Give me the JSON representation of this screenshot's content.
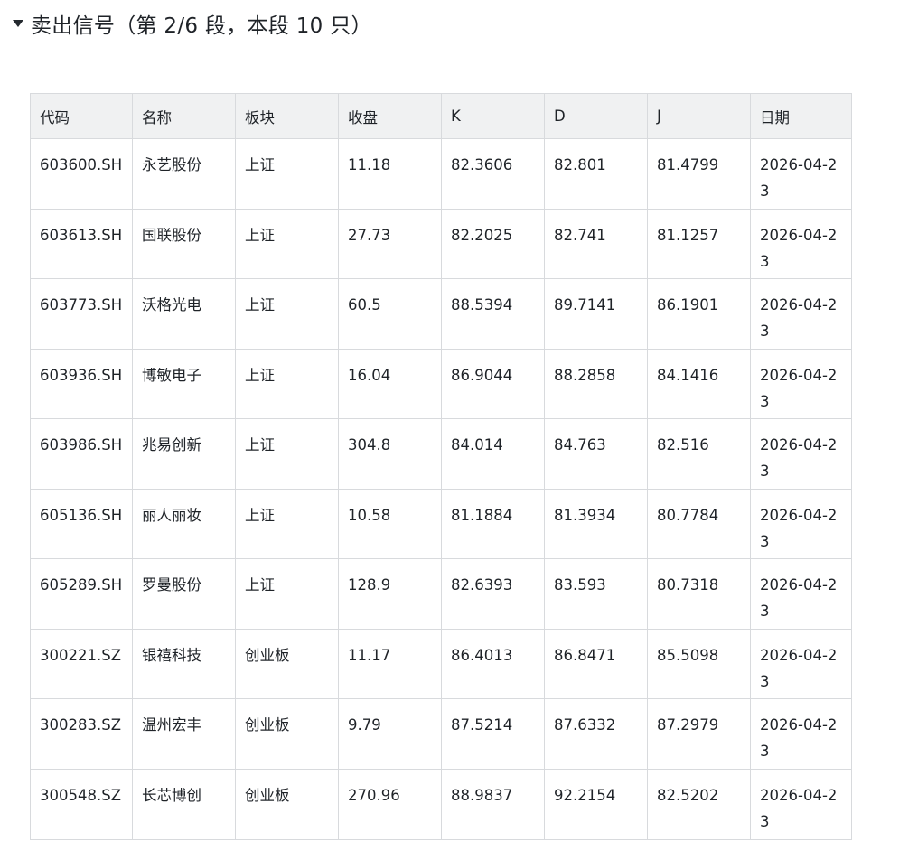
{
  "section": {
    "title": "卖出信号（第 2/6 段，本段 10 只）",
    "toggle_icon": "triangle-down-icon"
  },
  "table": {
    "headers": [
      "代码",
      "名称",
      "板块",
      "收盘",
      "K",
      "D",
      "J",
      "日期"
    ],
    "rows": [
      [
        "603600.SH",
        "永艺股份",
        "上证",
        "11.18",
        "82.3606",
        "82.801",
        "81.4799",
        "2026-04-23"
      ],
      [
        "603613.SH",
        "国联股份",
        "上证",
        "27.73",
        "82.2025",
        "82.741",
        "81.1257",
        "2026-04-23"
      ],
      [
        "603773.SH",
        "沃格光电",
        "上证",
        "60.5",
        "88.5394",
        "89.7141",
        "86.1901",
        "2026-04-23"
      ],
      [
        "603936.SH",
        "博敏电子",
        "上证",
        "16.04",
        "86.9044",
        "88.2858",
        "84.1416",
        "2026-04-23"
      ],
      [
        "603986.SH",
        "兆易创新",
        "上证",
        "304.8",
        "84.014",
        "84.763",
        "82.516",
        "2026-04-23"
      ],
      [
        "605136.SH",
        "丽人丽妆",
        "上证",
        "10.58",
        "81.1884",
        "81.3934",
        "80.7784",
        "2026-04-23"
      ],
      [
        "605289.SH",
        "罗曼股份",
        "上证",
        "128.9",
        "82.6393",
        "83.593",
        "80.7318",
        "2026-04-23"
      ],
      [
        "300221.SZ",
        "银禧科技",
        "创业板",
        "11.17",
        "86.4013",
        "86.8471",
        "85.5098",
        "2026-04-23"
      ],
      [
        "300283.SZ",
        "温州宏丰",
        "创业板",
        "9.79",
        "87.5214",
        "87.6332",
        "87.2979",
        "2026-04-23"
      ],
      [
        "300548.SZ",
        "长芯博创",
        "创业板",
        "270.96",
        "88.9837",
        "92.2154",
        "82.5202",
        "2026-04-23"
      ]
    ]
  }
}
